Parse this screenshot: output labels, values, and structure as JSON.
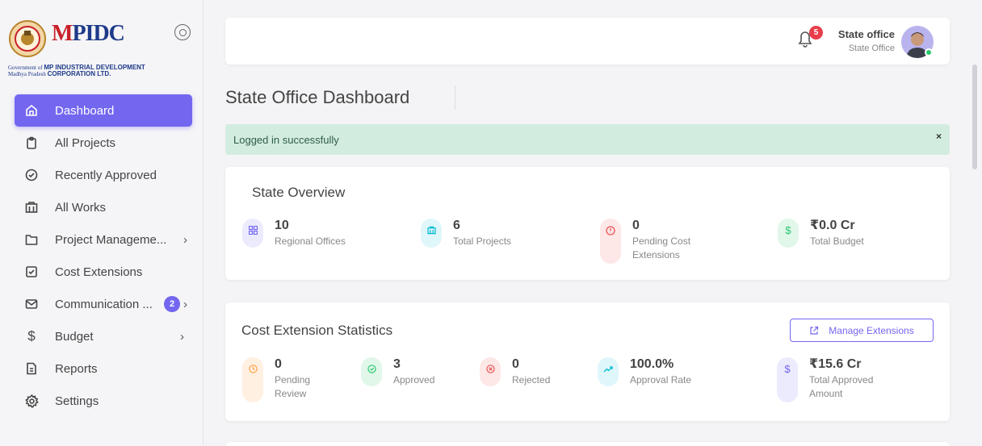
{
  "logo": {
    "brand_prefix": "M",
    "brand_rest": "PIDC",
    "line1_a": "Government of",
    "line1_b": "MP INDUSTRIAL DEVELOPMENT",
    "line2_a": "Madhya Pradesh",
    "line2_b": "CORPORATION LTD."
  },
  "sidebar": {
    "items": [
      {
        "label": "Dashboard",
        "icon": "home-icon"
      },
      {
        "label": "All Projects",
        "icon": "clipboard-icon"
      },
      {
        "label": "Recently Approved",
        "icon": "check-circle-icon"
      },
      {
        "label": "All Works",
        "icon": "building-icon"
      },
      {
        "label": "Project Manageme...",
        "icon": "folder-icon"
      },
      {
        "label": "Cost Extensions",
        "icon": "check-square-icon"
      },
      {
        "label": "Communication ...",
        "icon": "mail-icon",
        "badge": "2"
      },
      {
        "label": "Budget",
        "icon": "dollar-icon"
      },
      {
        "label": "Reports",
        "icon": "file-icon"
      },
      {
        "label": "Settings",
        "icon": "gear-icon"
      }
    ]
  },
  "topbar": {
    "notifications_count": "5",
    "user_name": "State office",
    "user_role": "State Office"
  },
  "page": {
    "title": "State Office Dashboard",
    "alert": "Logged in successfully",
    "alert_close": "×"
  },
  "overview": {
    "title": "State Overview",
    "stats": [
      {
        "value": "10",
        "label": "Regional Offices",
        "color": "#7367f0",
        "bg": "#ecebfd"
      },
      {
        "value": "6",
        "label": "Total Projects",
        "color": "#00bad1",
        "bg": "#dff7fa"
      },
      {
        "value": "0",
        "label": "Pending Cost Extensions",
        "color": "#ea5455",
        "bg": "#fde7e7"
      },
      {
        "value": "₹0.0 Cr",
        "label": "Total Budget",
        "color": "#28c76f",
        "bg": "#e0f7ea"
      }
    ]
  },
  "cost_stats": {
    "title": "Cost Extension Statistics",
    "button": "Manage Extensions",
    "stats": [
      {
        "value": "0",
        "label": "Pending Review",
        "color": "#ff9f43",
        "bg": "#fff0e1"
      },
      {
        "value": "3",
        "label": "Approved",
        "color": "#28c76f",
        "bg": "#e0f7ea"
      },
      {
        "value": "0",
        "label": "Rejected",
        "color": "#ea5455",
        "bg": "#fde7e7"
      },
      {
        "value": "100.0%",
        "label": "Approval Rate",
        "color": "#00bad1",
        "bg": "#dff7fa"
      },
      {
        "value": "₹15.6 Cr",
        "label": "Total Approved Amount",
        "color": "#7367f0",
        "bg": "#ecebfd"
      }
    ]
  }
}
